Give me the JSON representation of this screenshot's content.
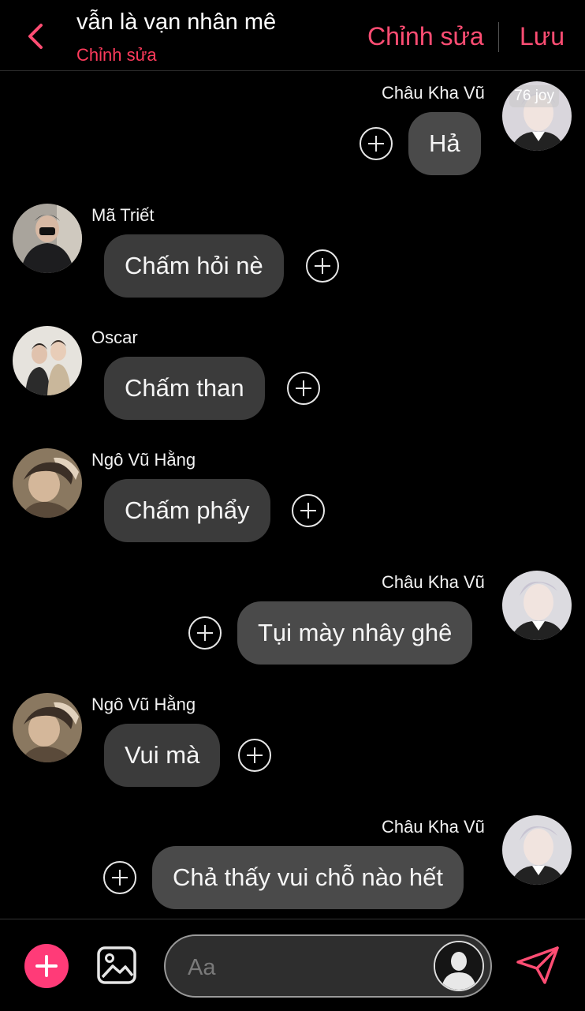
{
  "header": {
    "title": "vẫn là vạn nhân mê",
    "subtitle": "Chỉnh sửa",
    "edit_label": "Chỉnh sửa",
    "save_label": "Lưu",
    "accent": "#ff4d73"
  },
  "messages": [
    {
      "sender": "Châu Kha Vũ",
      "text": "Hả",
      "side": "right",
      "avatar_badge": "76 joy"
    },
    {
      "sender": "Mã Triết",
      "text": "Chấm hỏi nè",
      "side": "left"
    },
    {
      "sender": "Oscar",
      "text": "Chấm than",
      "side": "left"
    },
    {
      "sender": "Ngô Vũ Hằng",
      "text": "Chấm phẩy",
      "side": "left"
    },
    {
      "sender": "Châu Kha Vũ",
      "text": "Tụi mày nhây ghê",
      "side": "right"
    },
    {
      "sender": "Ngô Vũ Hằng",
      "text": "Vui mà",
      "side": "left"
    },
    {
      "sender": "Châu Kha Vũ",
      "text": "Chả thấy vui chỗ nào hết",
      "side": "right"
    }
  ],
  "composer": {
    "placeholder": "Aa",
    "add_icon": "plus-icon",
    "image_icon": "image-icon",
    "send_icon": "send-icon"
  }
}
